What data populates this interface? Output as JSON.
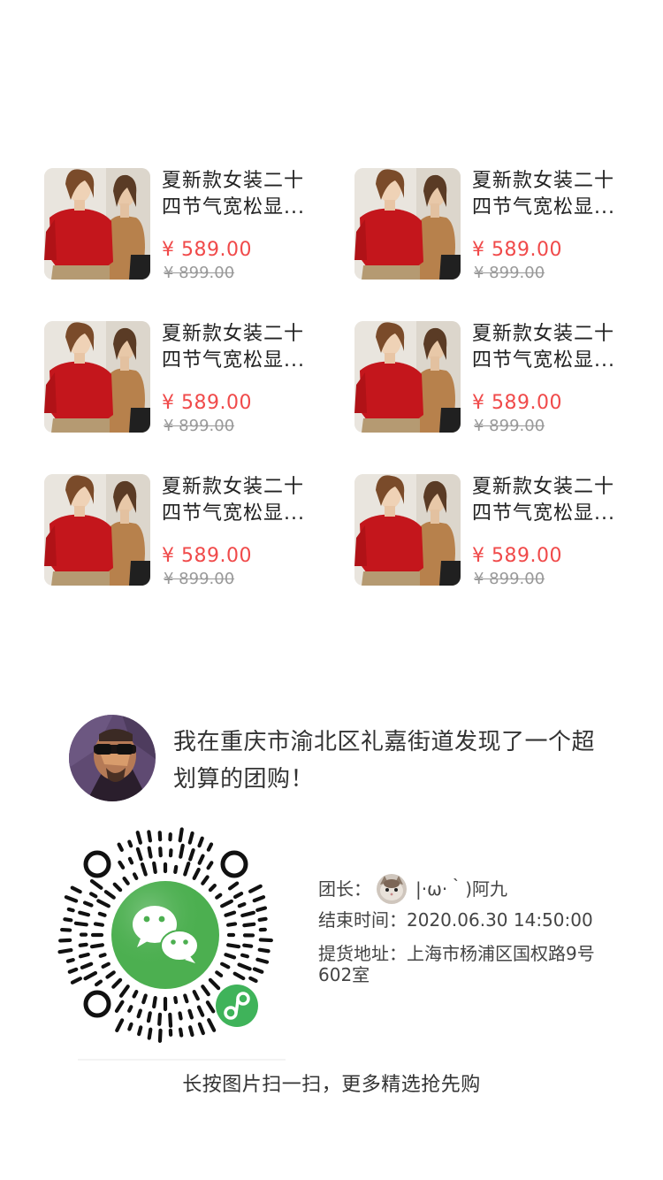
{
  "products": [
    {
      "title": "夏新款女装二十四节气宽松显...",
      "price": "¥ 589.00",
      "original_price": "¥ 899.00"
    },
    {
      "title": "夏新款女装二十四节气宽松显...",
      "price": "¥ 589.00",
      "original_price": "¥ 899.00"
    },
    {
      "title": "夏新款女装二十四节气宽松显...",
      "price": "¥ 589.00",
      "original_price": "¥ 899.00"
    },
    {
      "title": "夏新款女装二十四节气宽松显...",
      "price": "¥ 589.00",
      "original_price": "¥ 899.00"
    },
    {
      "title": "夏新款女装二十四节气宽松显...",
      "price": "¥ 589.00",
      "original_price": "¥ 899.00"
    },
    {
      "title": "夏新款女装二十四节气宽松显...",
      "price": "¥ 589.00",
      "original_price": "¥ 899.00"
    }
  ],
  "share": {
    "message": "我在重庆市渝北区礼嘉街道发现了一个超划算的团购！"
  },
  "details": {
    "leader_label": "团长：",
    "leader_name": "|·ω·｀)阿九",
    "end_label": "结束时间：",
    "end_time": "2020.06.30 14:50:00",
    "pickup_label": "提货地址：",
    "pickup_address": "上海市杨浦区国权路9号602室"
  },
  "hint": "长按图片扫一扫，更多精选抢先购",
  "colors": {
    "price_red": "#f04a4a",
    "wechat_green": "#4caf50"
  },
  "icons": {
    "qr": "mini-program-code",
    "logo": "wechat-icon",
    "badge": "mini-program-icon"
  }
}
